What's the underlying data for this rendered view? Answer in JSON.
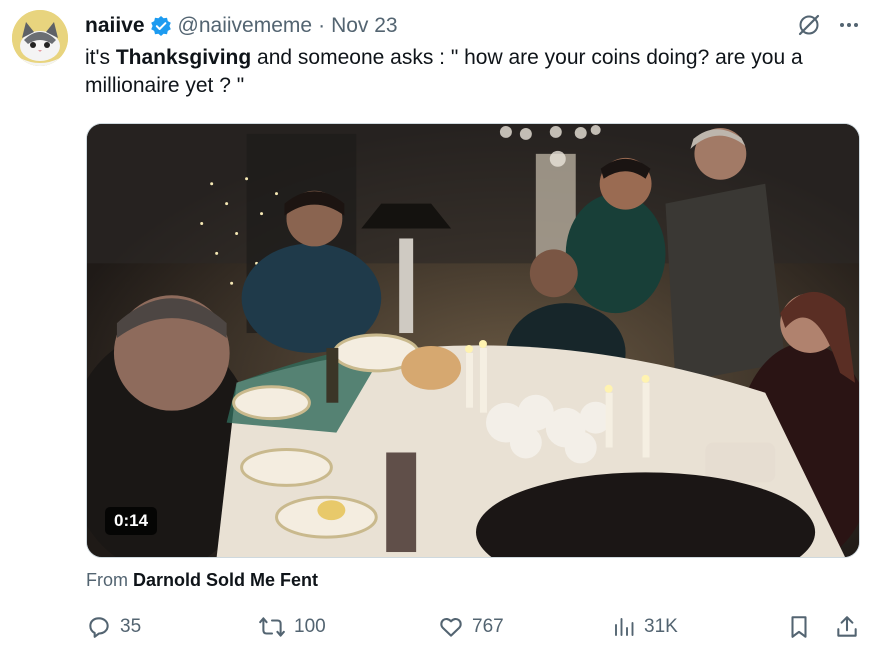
{
  "tweet": {
    "author_name": "naiive",
    "handle": "@naiivememe",
    "separator": "·",
    "date": "Nov 23",
    "text_pre": "it's ",
    "text_bold": "Thanksgiving",
    "text_post": " and someone asks : \" how are your coins doing? are you a millionaire yet ? \"",
    "icons": [
      "grok-icon",
      "more-icon"
    ]
  },
  "media": {
    "duration": "0:14"
  },
  "attribution": {
    "prefix": "From",
    "source": "Darnold Sold Me Fent"
  },
  "actions": {
    "replies": "35",
    "reposts": "100",
    "likes": "767",
    "views": "31K"
  },
  "colors": {
    "text": "#0f1419",
    "muted": "#536471",
    "verified": "#1d9bf0"
  }
}
